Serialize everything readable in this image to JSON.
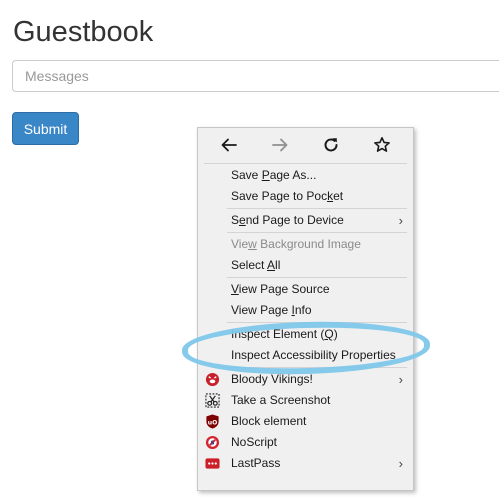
{
  "page": {
    "title": "Guestbook",
    "messages_placeholder": "Messages",
    "submit_label": "Submit"
  },
  "context_menu": {
    "nav": [
      "back-icon",
      "forward-icon",
      "reload-icon",
      "bookmark-star-icon"
    ],
    "items": {
      "save_page_as": {
        "pre": "Save ",
        "u": "P",
        "post": "age As..."
      },
      "save_page_to_pocket": {
        "pre": "Save Page to Poc",
        "u": "k",
        "post": "et"
      },
      "send_page_to_device": {
        "pre": "S",
        "u": "e",
        "post": "nd Page to Device",
        "arrow": "›"
      },
      "view_background_image": {
        "pre": "Vie",
        "u": "w",
        "post": " Background Image"
      },
      "select_all": {
        "pre": "Select ",
        "u": "A",
        "post": "ll"
      },
      "view_page_source": {
        "pre": "",
        "u": "V",
        "post": "iew Page Source"
      },
      "view_page_info": {
        "pre": "View Page ",
        "u": "I",
        "post": "nfo"
      },
      "inspect_element": {
        "pre": "Inspect Element (",
        "u": "Q",
        "post": ")"
      },
      "inspect_accessibility": {
        "pre": "Inspect Accessibility Properties",
        "u": "",
        "post": ""
      },
      "bloody_vikings": {
        "label": "Bloody Vikings!",
        "arrow": "›"
      },
      "take_screenshot": {
        "label": "Take a Screenshot"
      },
      "block_element": {
        "label": "Block element"
      },
      "noscript": {
        "label": "NoScript"
      },
      "lastpass": {
        "label": "LastPass",
        "arrow": "›"
      }
    }
  },
  "colors": {
    "submit_bg": "#3a87c8",
    "highlight_ring": "#7ec7ea",
    "menu_bg": "#f0f0f0"
  }
}
